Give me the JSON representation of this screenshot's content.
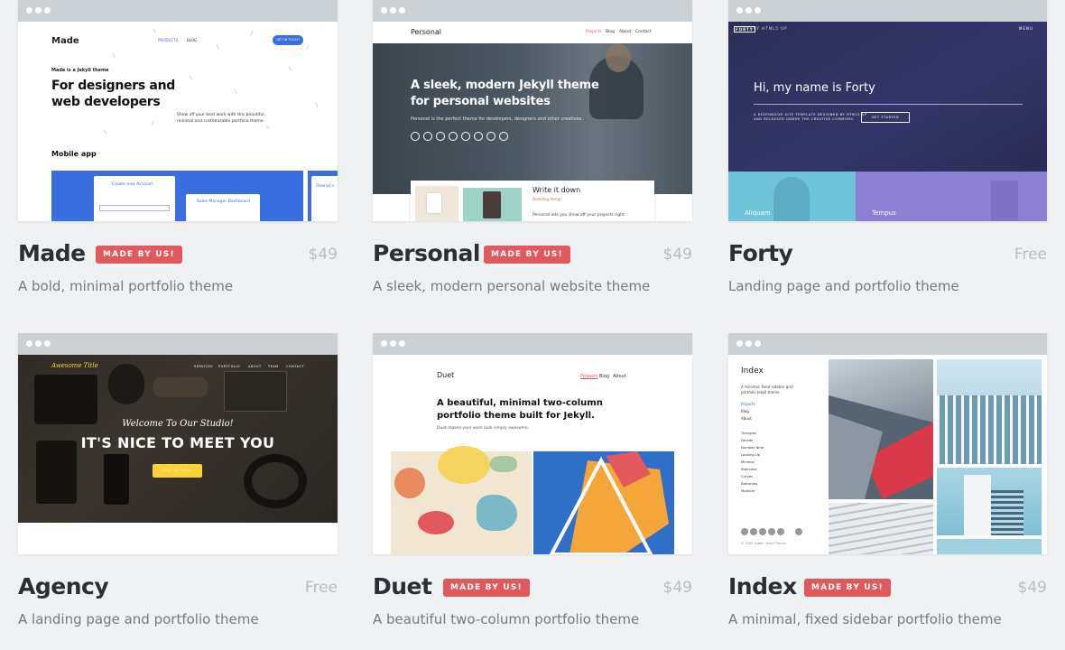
{
  "themes": [
    {
      "name": "Made",
      "badge": "MADE BY US!",
      "price": "$49",
      "description": "A bold, minimal portfolio theme",
      "preview": {
        "logo": "Made",
        "nav1": "PRODUCTS",
        "nav2": "BLOG",
        "cta": "GET IN TOUCH",
        "eyebrow": "Made is a Jekyll theme",
        "heading_line1": "For designers and",
        "heading_line2": "web developers",
        "blurb_line1": "Show off your best work with this beautiful,",
        "blurb_line2": "minimal and customizable portfolio theme.",
        "section": "Mobile app",
        "form_title": "Create new Account",
        "dashboard_title": "Sales Manager Dashboard",
        "side_title": "Overall s"
      }
    },
    {
      "name": "Personal",
      "badge": "MADE BY US!",
      "price": "$49",
      "description": "A sleek, modern personal website theme",
      "preview": {
        "logo": "Personal",
        "nav1": "Projects",
        "nav2": "Blog",
        "nav3": "About",
        "nav4": "Contact",
        "heading_line1": "A sleek, modern Jekyll theme",
        "heading_line2": "for personal websites",
        "blurb": "Personal is the perfect theme for developers, designers and other creatives.",
        "card_title": "Write it down",
        "card_tag": "Branding design",
        "card_text": "Personal lets you show off your projects right"
      }
    },
    {
      "name": "Forty",
      "badge": "",
      "price": "Free",
      "description": "Landing page and portfolio theme",
      "preview": {
        "logo": "FORTY",
        "logo_sub": "BY HTML5 UP",
        "menu": "MENU",
        "heading": "Hi, my name is Forty",
        "sub_line1": "A RESPONSIVE SITE TEMPLATE DESIGNED BY HTML5 UP",
        "sub_line2": "AND RELEASED UNDER THE CREATIVE COMMONS.",
        "button": "GET STARTED",
        "tile1": "Aliquam",
        "tile2": "Tempus"
      }
    },
    {
      "name": "Agency",
      "badge": "",
      "price": "Free",
      "description": "A landing page and portfolio theme",
      "preview": {
        "logo": "Awesome Title",
        "nav1": "SERVICES",
        "nav2": "PORTFOLIO",
        "nav3": "ABOUT",
        "nav4": "TEAM",
        "nav5": "CONTACT",
        "welcome": "Welcome To Our Studio!",
        "heading": "IT'S NICE TO MEET YOU",
        "button": "TELL ME MORE"
      }
    },
    {
      "name": "Duet",
      "badge": "MADE BY US!",
      "price": "$49",
      "description": "A beautiful two-column portfolio theme",
      "preview": {
        "logo": "Duet",
        "nav1": "Projects",
        "nav2": "Blog",
        "nav3": "About",
        "heading_line1": "A beautiful, minimal two-column",
        "heading_line2": "portfolio theme built for Jekyll.",
        "blurb": "Duet makes your work look simply awesome."
      }
    },
    {
      "name": "Index",
      "badge": "MADE BY US!",
      "price": "$49",
      "description": "A minimal, fixed sidebar portfolio theme",
      "preview": {
        "logo": "Index",
        "blurb_line1": "A minimal, fixed sidebar grid",
        "blurb_line2": "portfolio Jekyll theme.",
        "nav": [
          "Projects",
          "Blog",
          "About"
        ],
        "list": [
          "Triangles",
          "Facade",
          "Number Nine",
          "Looking Up",
          "Minimal",
          "Staircase",
          "Curves",
          "Balconies",
          "Modular"
        ],
        "footer": "© 2020 Index · Jekyll Theme"
      }
    }
  ],
  "colors": {
    "page_bg": "#f0f1f3",
    "badge": "#e2595d",
    "title": "#2b2e35",
    "description": "#727b85",
    "price": "#b8bcc2",
    "made_blue": "#3b6fe0",
    "forty_navy": "#2d2f5a",
    "forty_cyan": "#6fc3d8",
    "forty_purple": "#8d7fd1",
    "agency_yellow": "#fed136"
  },
  "icons": [
    "browser-dots-icon",
    "social-icon"
  ]
}
